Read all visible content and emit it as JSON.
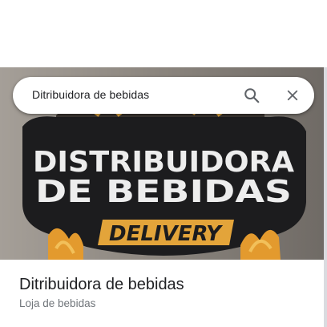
{
  "search": {
    "query": "Ditribuidora de bebidas"
  },
  "photo": {
    "logo_line1": "DISTRIBUIDORA",
    "logo_line2": "DE BEBIDAS",
    "logo_tag": "DELIVERY",
    "colors": {
      "logo_base": "#1c1c1e",
      "logo_text": "#eeeeee",
      "ribbon": "#e3a43a",
      "flame": "#f0b448",
      "background": "#8f8a84"
    }
  },
  "place": {
    "name": "Ditribuidora de bebidas",
    "category": "Loja de bebidas"
  },
  "icons": {
    "search": "search-icon",
    "close": "close-icon"
  }
}
